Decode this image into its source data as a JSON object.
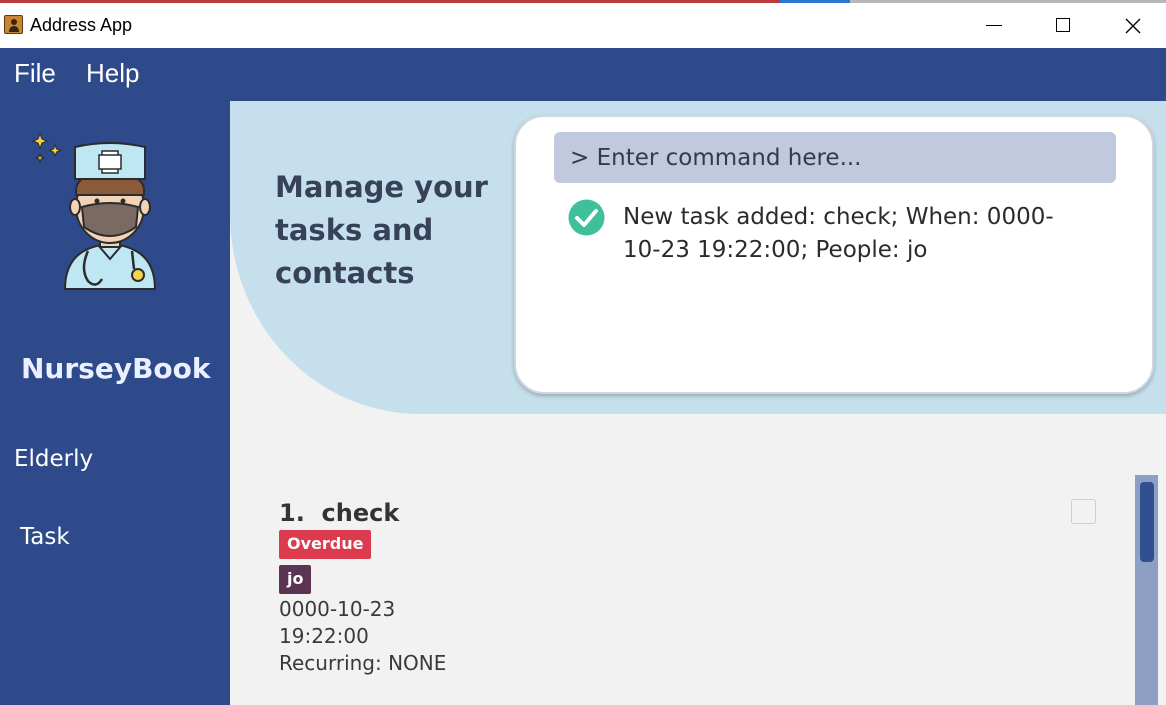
{
  "window": {
    "title": "Address App",
    "controls": [
      "minimize-icon",
      "maximize-icon",
      "close-icon"
    ]
  },
  "menu": {
    "items": [
      {
        "label": "File"
      },
      {
        "label": "Help"
      }
    ]
  },
  "sidebar": {
    "brand": "NurseyBook",
    "logo_icon": "nurse-avatar-icon",
    "items": [
      {
        "label": "Elderly"
      },
      {
        "label": "Task"
      }
    ]
  },
  "hero": {
    "tagline": "Manage your tasks and contacts"
  },
  "command": {
    "placeholder": "> Enter command here...",
    "result_icon": "check-circle-icon",
    "result_text": "New task added: check; When: 0000-10-23 19:22:00; People: jo"
  },
  "tasks": [
    {
      "index": "1.",
      "title": "check",
      "status_badge": "Overdue",
      "person": "jo",
      "date": "0000-10-23",
      "time": "19:22:00",
      "recurring": "Recurring: NONE"
    }
  ],
  "colors": {
    "primary": "#2f4a8a",
    "hero": "#c5e0ec",
    "overdue": "#dc3a4f",
    "person_tag": "#5a3450",
    "success": "#3fbf9a"
  }
}
